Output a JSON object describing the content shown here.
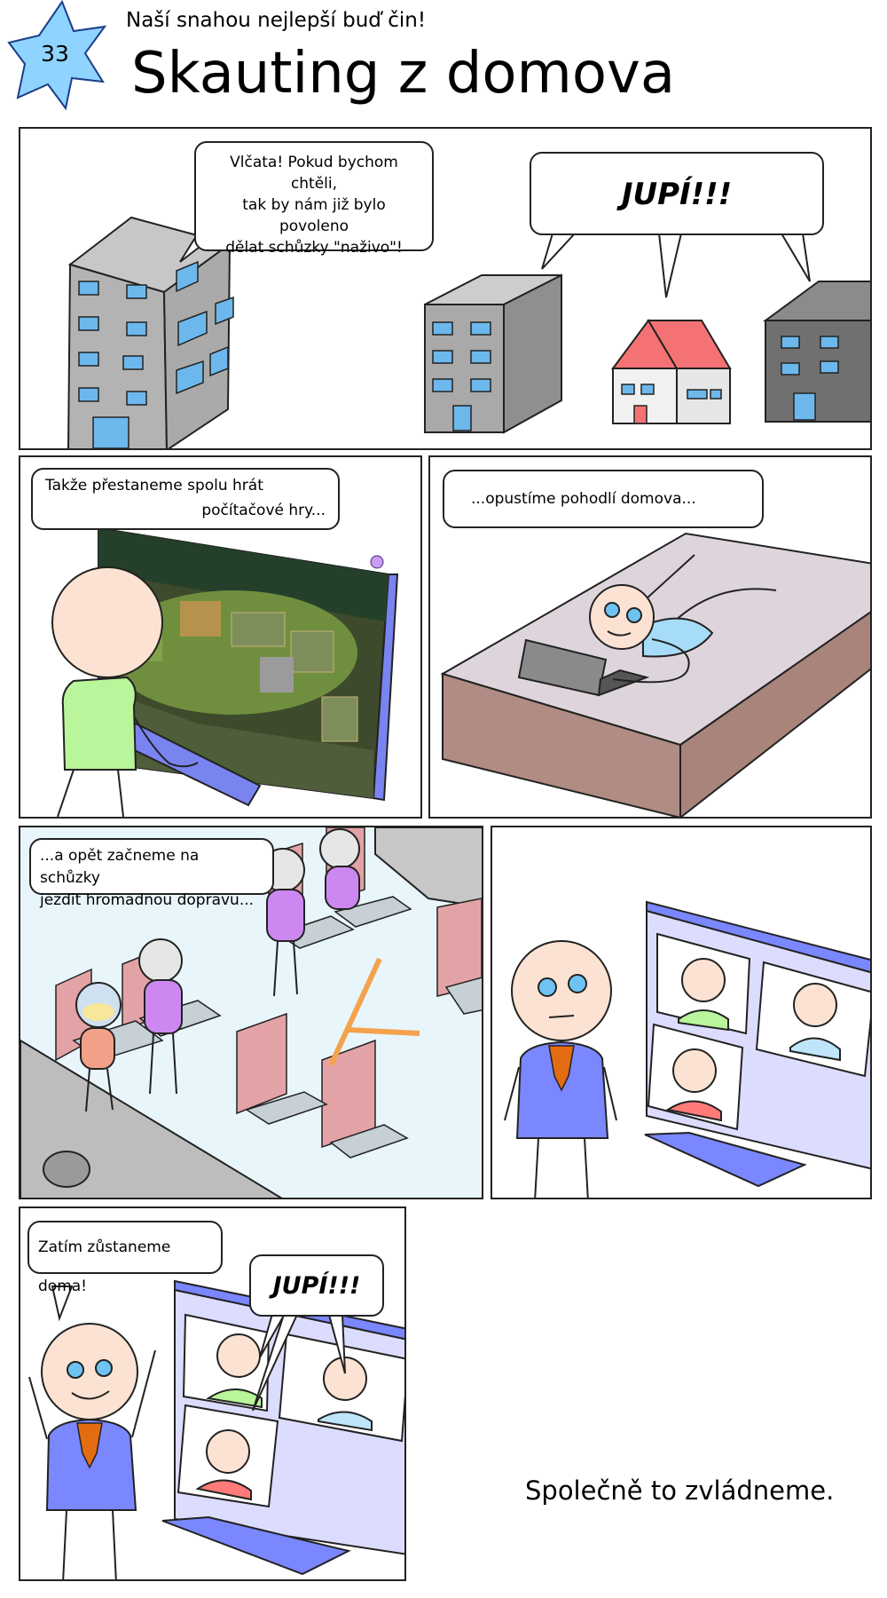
{
  "header": {
    "issue_number": "33",
    "subtitle": "Naší snahou nejlepší buď čin!",
    "title": "Skauting z domova"
  },
  "panels": [
    {
      "speech": [
        "Vlčata! Pokud bychom chtěli,",
        "tak by nám již bylo povoleno",
        "dělat schůzky \"naživo\"!"
      ],
      "shout": "JUPÍ!!!"
    },
    {
      "speech": [
        "Takže přestaneme spolu hrát",
        "počítačové hry..."
      ]
    },
    {
      "speech": [
        "...opustíme pohodlí domova..."
      ]
    },
    {
      "speech": [
        "...a opět začneme na schůzky",
        "jezdit hromadnou dopravu..."
      ]
    },
    {},
    {
      "speech": [
        "Zatím zůstaneme doma!"
      ],
      "shout": "JUPÍ!!!"
    }
  ],
  "closing": "Společně to zvládneme.",
  "colors": {
    "star": "#8fd3ff",
    "skin": "#fbe2d2",
    "eye": "#6ec3f3",
    "scarf": "#e36b12",
    "scout_shirt": "#7a87ff",
    "roof": "#f47273",
    "screen": "#dcdcff",
    "seat": "#e3a3a6"
  }
}
